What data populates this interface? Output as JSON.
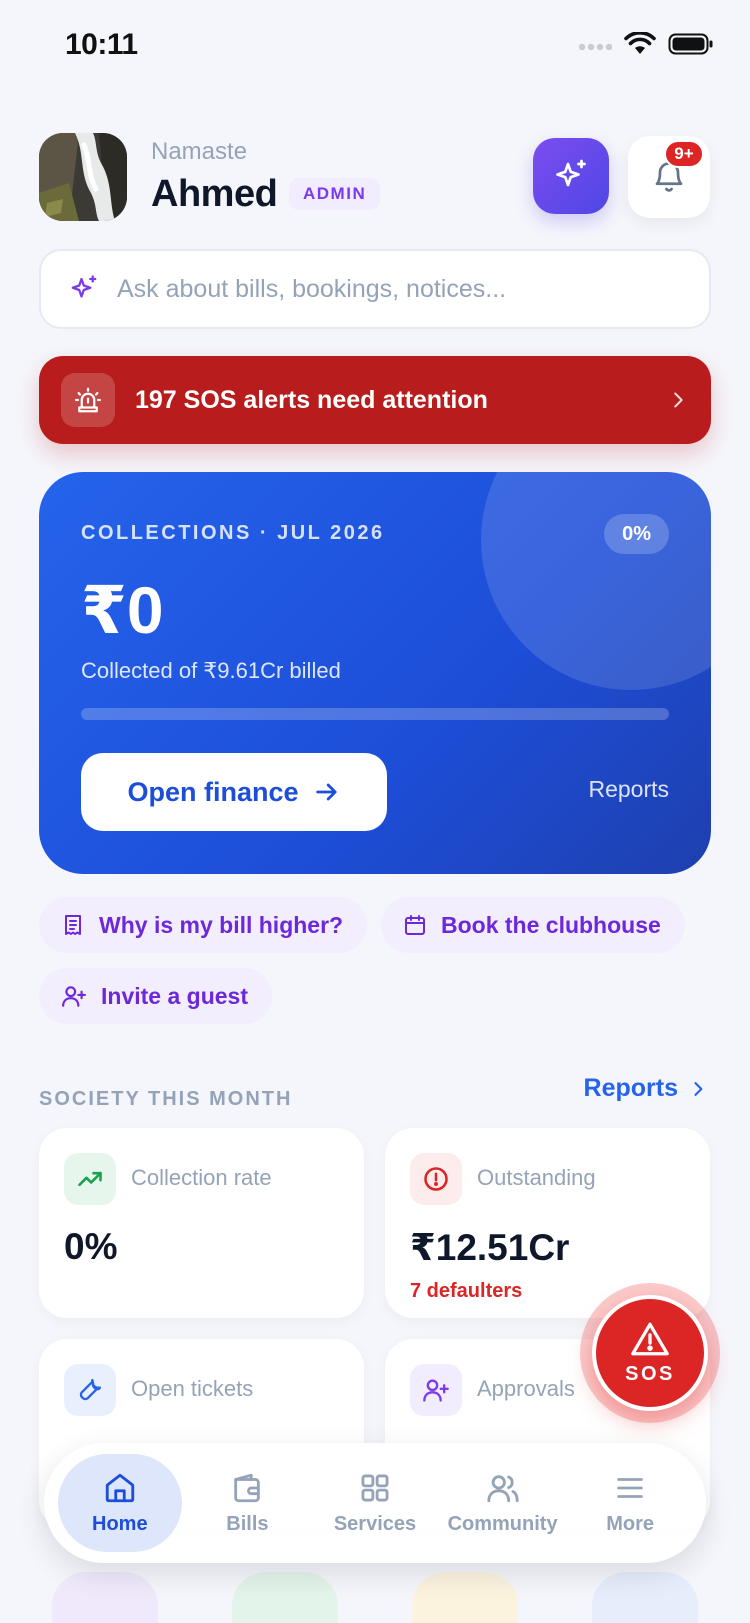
{
  "status_bar": {
    "time": "10:11"
  },
  "header": {
    "greeting": "Namaste",
    "user_name": "Ahmed",
    "role_badge": "ADMIN",
    "notification_badge": "9+"
  },
  "search": {
    "placeholder": "Ask about bills, bookings, notices..."
  },
  "sos_banner": {
    "text": "197 SOS alerts need attention"
  },
  "collections": {
    "label": "COLLECTIONS · JUL 2026",
    "percent_label": "0%",
    "progress_percent": 0,
    "amount": "₹0",
    "subtitle": "Collected of ₹9.61Cr billed",
    "primary_button": "Open finance",
    "secondary_link": "Reports"
  },
  "quick_actions": [
    {
      "label": "Why is my bill higher?",
      "icon": "receipt-icon"
    },
    {
      "label": "Book the clubhouse",
      "icon": "calendar-icon"
    },
    {
      "label": "Invite a guest",
      "icon": "user-plus-icon"
    }
  ],
  "society": {
    "title": "SOCIETY THIS MONTH",
    "link": "Reports",
    "stats": [
      {
        "label": "Collection rate",
        "value": "0%",
        "note": "",
        "icon": "trending-up-icon",
        "color": "#16a34a"
      },
      {
        "label": "Outstanding",
        "value": "₹12.51Cr",
        "note": "7 defaulters",
        "icon": "alert-circle-icon",
        "color": "#dc2626"
      },
      {
        "label": "Open tickets",
        "value": "",
        "note": "",
        "icon": "wrench-icon",
        "color": "#2563eb"
      },
      {
        "label": "Approvals",
        "value": "",
        "note": "",
        "icon": "user-plus-icon",
        "color": "#7c3aed"
      }
    ]
  },
  "sos_button": {
    "label": "SOS"
  },
  "bottom_nav": {
    "items": [
      {
        "label": "Home",
        "icon": "home-icon",
        "active": true
      },
      {
        "label": "Bills",
        "icon": "wallet-icon",
        "active": false
      },
      {
        "label": "Services",
        "icon": "grid-icon",
        "active": false
      },
      {
        "label": "Community",
        "icon": "users-icon",
        "active": false
      },
      {
        "label": "More",
        "icon": "menu-icon",
        "active": false
      }
    ]
  },
  "colors": {
    "accent": "#2563eb",
    "purple": "#7c3aed",
    "danger": "#b91c1c",
    "sos": "#dc2626"
  }
}
